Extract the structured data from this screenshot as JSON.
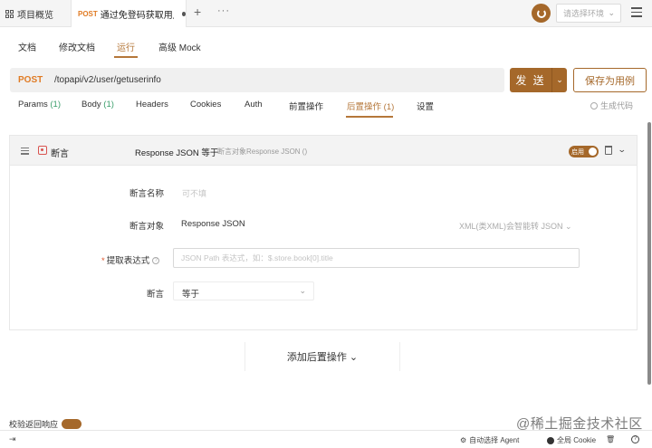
{
  "tabbar": {
    "overview_label": "项目概览",
    "active_tab_method": "POST",
    "active_tab_title": "通过免登码获取用户",
    "plus": "+",
    "more": "···",
    "env_placeholder": "请选择环境"
  },
  "subnav": {
    "items": [
      "文档",
      "修改文档",
      "运行",
      "高级 Mock"
    ],
    "active": "运行"
  },
  "request": {
    "method": "POST",
    "path": "/topapi/v2/user/getuserinfo",
    "send_label": "发 送",
    "save_case_label": "保存为用例"
  },
  "req_tabs": {
    "items": [
      {
        "label": "Params",
        "count": "(1)"
      },
      {
        "label": "Body",
        "count": "(1)"
      },
      {
        "label": "Headers",
        "count": ""
      },
      {
        "label": "Cookies",
        "count": ""
      },
      {
        "label": "Auth",
        "count": ""
      },
      {
        "label": "前置操作",
        "count": ""
      },
      {
        "label": "后置操作",
        "count": "(1)"
      },
      {
        "label": "设置",
        "count": ""
      }
    ],
    "active": "后置操作",
    "gen_code_label": "生成代码"
  },
  "assertion": {
    "title": "断言",
    "summary": "Response JSON 等于",
    "sub": "断言对象Response JSON ()",
    "enable_label": "启用",
    "name_label": "断言名称",
    "name_placeholder": "可不填",
    "target_label": "断言对象",
    "target_value": "Response JSON",
    "target_hint": "XML(类XML)会智能转 JSON",
    "expr_label": "提取表达式",
    "expr_required": "*",
    "expr_placeholder": "JSON Path 表达式，如：$.store.book[0].title",
    "op_label": "断言",
    "op_value": "等于"
  },
  "add_postop_label": "添加后置操作",
  "bottom": {
    "hidden_row_label": "校验返回响应",
    "agent_label": "自动选择 Agent",
    "cookie_label": "全局 Cookie",
    "watermark": "@稀土掘金技术社区"
  },
  "colors": {
    "brand": "#a5682a",
    "method": "#e07b24",
    "count": "#3b9e6b"
  }
}
